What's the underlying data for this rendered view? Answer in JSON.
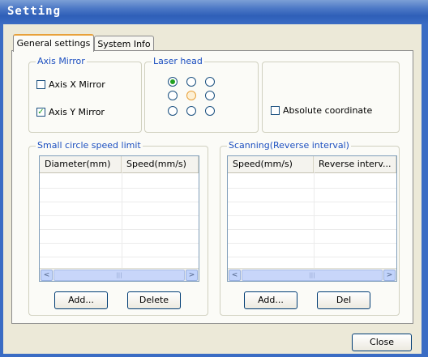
{
  "window": {
    "title": "Setting"
  },
  "tabs": [
    {
      "label": "General settings",
      "active": true
    },
    {
      "label": "System Info",
      "active": false
    }
  ],
  "axis_mirror": {
    "legend": "Axis Mirror",
    "x_mirror": {
      "label": "Axis X Mirror",
      "checked": false
    },
    "y_mirror": {
      "label": "Axis Y Mirror",
      "checked": true
    }
  },
  "laser_head": {
    "legend": "Laser head",
    "selected_index": 0,
    "hover_index": 4
  },
  "absolute_coordinate": {
    "label": "Absolute coordinate",
    "checked": false
  },
  "small_circle": {
    "legend": "Small circle speed limit",
    "columns": [
      "Diameter(mm)",
      "Speed(mm/s)"
    ],
    "rows": [],
    "add_label": "Add...",
    "delete_label": "Delete"
  },
  "scanning": {
    "legend": "Scanning(Reverse interval)",
    "columns": [
      "Speed(mm/s)",
      "Reverse interv..."
    ],
    "rows": [],
    "add_label": "Add...",
    "del_label": "Del"
  },
  "footer": {
    "close_label": "Close"
  },
  "colors": {
    "title_bar": "#2f5fb8",
    "legend_text": "#1c4fc0",
    "dialog_bg": "#ece9d8",
    "check_mark": "#21a121",
    "tab_highlight": "#e8a13a"
  }
}
